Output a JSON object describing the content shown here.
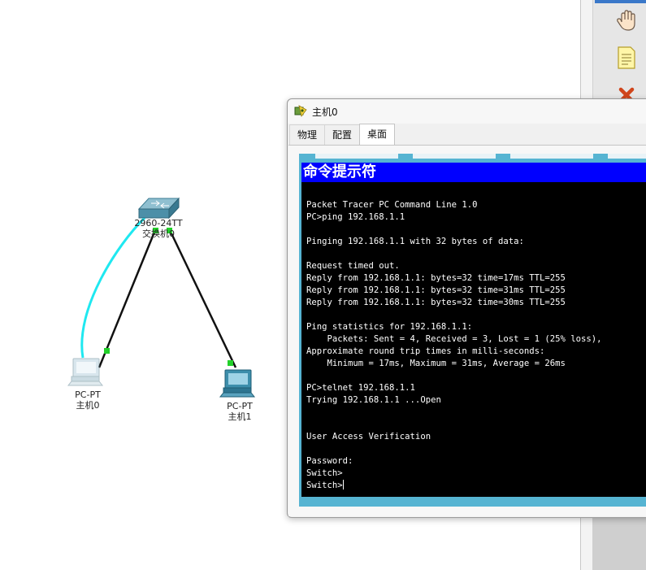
{
  "topology": {
    "switch": {
      "model": "2960-24TT",
      "name": "交换机0"
    },
    "hosts": [
      {
        "type": "PC-PT",
        "name": "主机0"
      },
      {
        "type": "PC-PT",
        "name": "主机1"
      }
    ],
    "colors": {
      "console_cable": "#1fe8f0",
      "ethernet_cable": "#111111",
      "link_up": "#22d12a"
    }
  },
  "window": {
    "title": "主机0",
    "tabs": [
      {
        "label": "物理",
        "active": false
      },
      {
        "label": "配置",
        "active": false
      },
      {
        "label": "桌面",
        "active": true
      }
    ]
  },
  "terminal": {
    "title": "命令提示符",
    "lines": [
      "",
      "Packet Tracer PC Command Line 1.0",
      "PC>ping 192.168.1.1",
      "",
      "Pinging 192.168.1.1 with 32 bytes of data:",
      "",
      "Request timed out.",
      "Reply from 192.168.1.1: bytes=32 time=17ms TTL=255",
      "Reply from 192.168.1.1: bytes=32 time=31ms TTL=255",
      "Reply from 192.168.1.1: bytes=32 time=30ms TTL=255",
      "",
      "Ping statistics for 192.168.1.1:",
      "    Packets: Sent = 4, Received = 3, Lost = 1 (25% loss),",
      "Approximate round trip times in milli-seconds:",
      "    Minimum = 17ms, Maximum = 31ms, Average = 26ms",
      "",
      "PC>telnet 192.168.1.1",
      "Trying 192.168.1.1 ...Open",
      "",
      "",
      "User Access Verification",
      "",
      "Password:",
      "Switch>",
      "Switch>"
    ]
  },
  "toolbar": {
    "tools": [
      {
        "icon": "hand-icon"
      },
      {
        "icon": "note-icon"
      },
      {
        "icon": "delete-icon"
      }
    ]
  }
}
